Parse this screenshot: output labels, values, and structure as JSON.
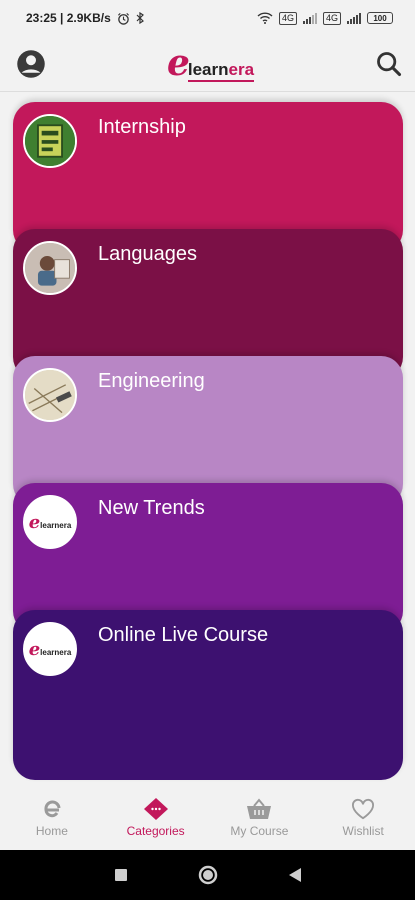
{
  "status_bar": {
    "time_speed": "23:25 | 2.9KB/s",
    "sim1": "4G",
    "sim2": "4G",
    "battery": "100"
  },
  "header": {
    "logo_initial": "e",
    "logo_main": "learn",
    "logo_accent": "era",
    "profile_icon": "account-circle-icon",
    "search_icon": "search-icon"
  },
  "categories": [
    {
      "label": "Internship",
      "color": "#c2185b"
    },
    {
      "label": "Languages",
      "color": "#7b1046"
    },
    {
      "label": "Engineering",
      "color": "#b886c5"
    },
    {
      "label": "New Trends",
      "color": "#7e1d94"
    },
    {
      "label": "Online Live Course",
      "color": "#3d1170"
    }
  ],
  "thumb_logo": {
    "initial": "e",
    "text": "learnera"
  },
  "bottom_nav": [
    {
      "label": "Home",
      "icon": "e-logo-icon"
    },
    {
      "label": "Categories",
      "icon": "categories-icon",
      "active": true
    },
    {
      "label": "My Course",
      "icon": "basket-icon"
    },
    {
      "label": "Wishlist",
      "icon": "heart-icon"
    }
  ],
  "colors": {
    "accent": "#c2185b",
    "inactive": "#999999"
  }
}
